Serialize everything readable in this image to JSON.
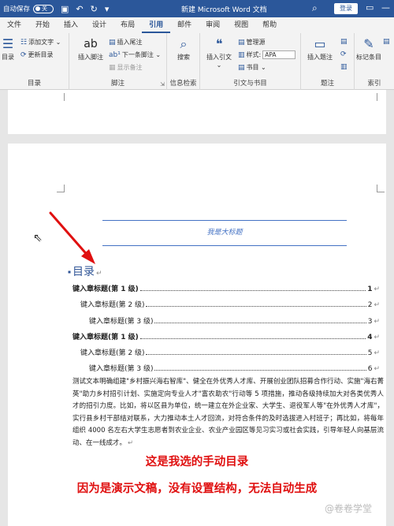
{
  "titlebar": {
    "autosave_label": "自动保存",
    "autosave_state": "关",
    "doc_title": "新建 Microsoft Word 文档",
    "login": "登录"
  },
  "tabs": [
    "文件",
    "开始",
    "插入",
    "设计",
    "布局",
    "引用",
    "邮件",
    "审阅",
    "视图",
    "帮助"
  ],
  "active_tab": "引用",
  "ribbon": {
    "toc_group": {
      "label": "目录",
      "toc_btn": "目录",
      "add_text": "添加文字",
      "update_toc": "更新目录"
    },
    "footnote_group": {
      "label": "脚注",
      "insert_footnote": "插入脚注",
      "insert_endnote": "插入尾注",
      "next_footnote": "下一条脚注",
      "show_notes": "显示备注",
      "ab_icon_text": "ab"
    },
    "research_group": {
      "label": "信息检索",
      "search": "搜索"
    },
    "citation_group": {
      "label": "引文与书目",
      "insert_citation": "插入引文",
      "manage_sources": "管理源",
      "style_label": "样式:",
      "style_value": "APA",
      "bibliography": "书目"
    },
    "caption_group": {
      "label": "题注",
      "insert_caption": "插入题注"
    },
    "index_group": {
      "label": "索引",
      "mark_entry": "标记条目"
    }
  },
  "document": {
    "header_title": "我是大标题",
    "toc_heading": "目录",
    "toc_entries": [
      {
        "text": "键入章标题(第 1 级)",
        "page": "1",
        "level": 1
      },
      {
        "text": "键入章标题(第 2 级)",
        "page": "2",
        "level": 2
      },
      {
        "text": "键入章标题(第 3 级)",
        "page": "3",
        "level": 3
      },
      {
        "text": "键入章标题(第 1 级)",
        "page": "4",
        "level": 1
      },
      {
        "text": "键入章标题(第 2 级)",
        "page": "5",
        "level": 2
      },
      {
        "text": "键入章标题(第 3 级)",
        "page": "6",
        "level": 3
      }
    ],
    "body_text": "测试文本明确组建\"乡村振兴海右智库\"、健全在外优秀人才库、开展创业团队招募合作行动、实施\"海右菁英\"助力乡村招引计划、实施定向专业人才\"富农助农\"行动等 5 项措施，推动各级持续加大对各类优秀人才的招引力度。比如，将以区县为单位，统一建立在外企业家、大学生、退役军人等\"在外优秀人才库\"，实行县乡村干部结对联系，大力推动本土人才回流，对符合条件的及时选拔进入村班子；再比如，将每年组织 4000 名左右大学生志愿者到农业企业、农业产业园区等见习实习或社会实践，引导年轻人向基层流动、在一线成才。"
  },
  "annotations": {
    "caption1": "这是我选的手动目录",
    "caption2": "因为是演示文稿，没有设置结构，无法自动生成",
    "arrow_color": "#e01010"
  },
  "watermark": "@卷卷学堂",
  "colors": {
    "title_bar": "#2b579a",
    "heading_blue": "#2f5496",
    "header_line": "#4472c4"
  }
}
